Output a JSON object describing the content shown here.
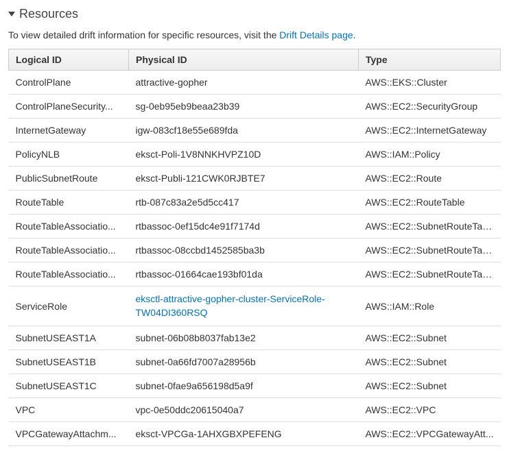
{
  "section": {
    "title": "Resources",
    "subtext_prefix": "To view detailed drift information for specific resources, visit the ",
    "subtext_link": "Drift Details page",
    "subtext_suffix": "."
  },
  "table": {
    "headers": {
      "logical": "Logical ID",
      "physical": "Physical ID",
      "type": "Type"
    },
    "rows": [
      {
        "logical": "ControlPlane",
        "physical": "attractive-gopher",
        "physical_link": false,
        "type": "AWS::EKS::Cluster"
      },
      {
        "logical": "ControlPlaneSecurity...",
        "physical": "sg-0eb95eb9beaa23b39",
        "physical_link": false,
        "type": "AWS::EC2::SecurityGroup"
      },
      {
        "logical": "InternetGateway",
        "physical": "igw-083cf18e55e689fda",
        "physical_link": false,
        "type": "AWS::EC2::InternetGateway"
      },
      {
        "logical": "PolicyNLB",
        "physical": "eksct-Poli-1V8NNKHVPZ10D",
        "physical_link": false,
        "type": "AWS::IAM::Policy"
      },
      {
        "logical": "PublicSubnetRoute",
        "physical": "eksct-Publi-121CWK0RJBTE7",
        "physical_link": false,
        "type": "AWS::EC2::Route"
      },
      {
        "logical": "RouteTable",
        "physical": "rtb-087c83a2e5d5cc417",
        "physical_link": false,
        "type": "AWS::EC2::RouteTable"
      },
      {
        "logical": "RouteTableAssociatio...",
        "physical": "rtbassoc-0ef15dc4e91f7174d",
        "physical_link": false,
        "type": "AWS::EC2::SubnetRouteTab..."
      },
      {
        "logical": "RouteTableAssociatio...",
        "physical": "rtbassoc-08ccbd1452585ba3b",
        "physical_link": false,
        "type": "AWS::EC2::SubnetRouteTab..."
      },
      {
        "logical": "RouteTableAssociatio...",
        "physical": "rtbassoc-01664cae193bf01da",
        "physical_link": false,
        "type": "AWS::EC2::SubnetRouteTab..."
      },
      {
        "logical": "ServiceRole",
        "physical": "eksctl-attractive-gopher-cluster-ServiceRole-TW04DI360RSQ",
        "physical_link": true,
        "type": "AWS::IAM::Role"
      },
      {
        "logical": "SubnetUSEAST1A",
        "physical": "subnet-06b08b8037fab13e2",
        "physical_link": false,
        "type": "AWS::EC2::Subnet"
      },
      {
        "logical": "SubnetUSEAST1B",
        "physical": "subnet-0a66fd7007a28956b",
        "physical_link": false,
        "type": "AWS::EC2::Subnet"
      },
      {
        "logical": "SubnetUSEAST1C",
        "physical": "subnet-0fae9a656198d5a9f",
        "physical_link": false,
        "type": "AWS::EC2::Subnet"
      },
      {
        "logical": "VPC",
        "physical": "vpc-0e50ddc20615040a7",
        "physical_link": false,
        "type": "AWS::EC2::VPC"
      },
      {
        "logical": "VPCGatewayAttachm...",
        "physical": "eksct-VPCGa-1AHXGBXPEFENG",
        "physical_link": false,
        "type": "AWS::EC2::VPCGatewayAtt..."
      }
    ]
  }
}
